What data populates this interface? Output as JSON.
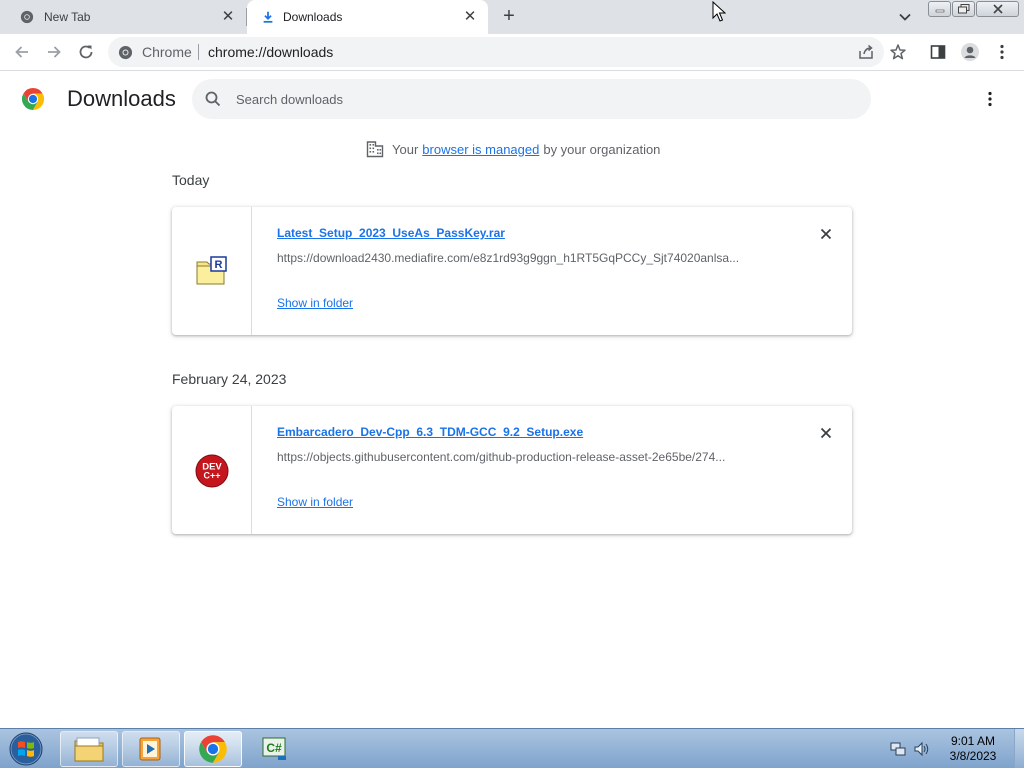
{
  "browser": {
    "tabs": [
      {
        "title": "New Tab",
        "icon": "chrome-icon"
      },
      {
        "title": "Downloads",
        "icon": "download-icon",
        "active": true
      }
    ],
    "site_chip": "Chrome",
    "url": "chrome://downloads"
  },
  "downloads": {
    "page_title": "Downloads",
    "search_placeholder": "Search downloads",
    "managed": {
      "prefix": "Your",
      "link": "browser is managed",
      "suffix": "by your organization"
    },
    "groups": [
      {
        "date": "Today",
        "items": [
          {
            "filename": "Latest_Setup_2023_UseAs_PassKey.rar",
            "url": "https://download2430.mediafire.com/e8z1rd93g9ggn_h1RT5GqPCCy_Sjt74020anlsa...",
            "action": "Show in folder",
            "icon": "rar-archive-icon"
          }
        ]
      },
      {
        "date": "February 24, 2023",
        "items": [
          {
            "filename": "Embarcadero_Dev-Cpp_6.3_TDM-GCC_9.2_Setup.exe",
            "url": "https://objects.githubusercontent.com/github-production-release-asset-2e65be/274...",
            "action": "Show in folder",
            "icon": "devcpp-icon",
            "icon_text_top": "DEV",
            "icon_text_bottom": "C++"
          }
        ]
      }
    ]
  },
  "taskbar": {
    "apps": [
      "windows-explorer-icon",
      "media-player-icon",
      "chrome-icon",
      "csharp-ide-icon"
    ],
    "clock_time": "9:01 AM",
    "clock_date": "3/8/2023"
  },
  "colors": {
    "link": "#1a73e8",
    "tabstrip": "#dee1e6",
    "omnibox": "#f1f3f4",
    "taskbar": "#8fb0d6"
  }
}
